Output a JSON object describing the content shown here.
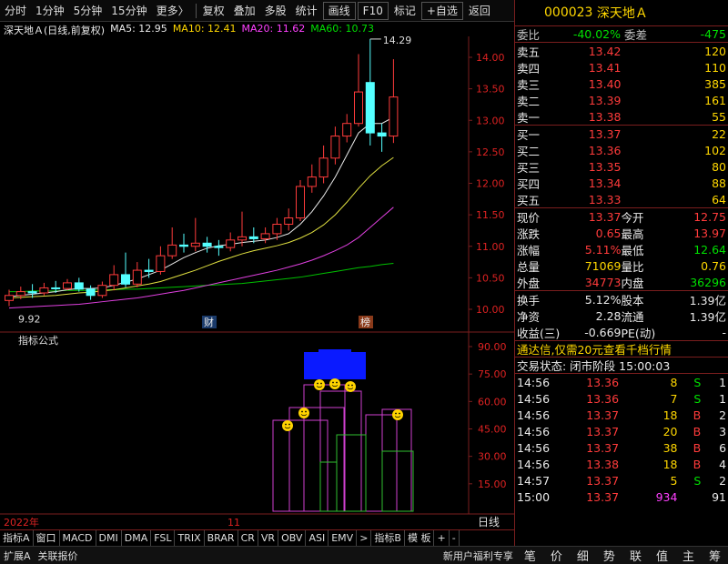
{
  "toolbar": {
    "items": [
      "分时",
      "1分钟",
      "5分钟",
      "15分钟",
      "更多〉"
    ],
    "buttons": [
      "复权",
      "叠加",
      "多股",
      "统计",
      "画线",
      "F10",
      "标记",
      "+自选",
      "返回"
    ]
  },
  "legend": {
    "name": "深天地Ａ(日线,前复权)",
    "ma5": "MA5: 12.95",
    "ma10": "MA10: 12.41",
    "ma20": "MA20: 11.62",
    "ma60": "MA60: 10.73"
  },
  "chart_data": {
    "type": "candlestick",
    "price_axis": [
      "14.00",
      "13.50",
      "13.00",
      "12.50",
      "12.00",
      "11.50",
      "11.00",
      "10.50",
      "10.00"
    ],
    "high_label": "14.29",
    "low_label": "9.92",
    "markers": [
      "财",
      "榜"
    ],
    "indicator_title": "指标公式",
    "indicator_axis": [
      "90.00",
      "75.00",
      "60.00",
      "45.00",
      "30.00",
      "15.00"
    ],
    "date_labels": [
      "2022年",
      "11"
    ],
    "daily_label": "日线",
    "candles": [
      {
        "o": 10.14,
        "c": 10.22,
        "h": 10.31,
        "l": 10.05
      },
      {
        "o": 10.22,
        "c": 10.28,
        "h": 10.36,
        "l": 10.16
      },
      {
        "o": 10.28,
        "c": 10.26,
        "h": 10.4,
        "l": 10.18
      },
      {
        "o": 10.26,
        "c": 10.34,
        "h": 10.42,
        "l": 10.22
      },
      {
        "o": 10.34,
        "c": 10.33,
        "h": 10.45,
        "l": 10.26
      },
      {
        "o": 10.33,
        "c": 10.42,
        "h": 10.48,
        "l": 10.3
      },
      {
        "o": 10.42,
        "c": 10.32,
        "h": 10.5,
        "l": 10.28
      },
      {
        "o": 10.32,
        "c": 10.22,
        "h": 10.38,
        "l": 10.15
      },
      {
        "o": 10.22,
        "c": 10.38,
        "h": 10.44,
        "l": 10.18
      },
      {
        "o": 10.38,
        "c": 10.55,
        "h": 10.7,
        "l": 10.3
      },
      {
        "o": 10.55,
        "c": 10.4,
        "h": 10.9,
        "l": 10.35
      },
      {
        "o": 10.4,
        "c": 10.62,
        "h": 10.75,
        "l": 10.35
      },
      {
        "o": 10.62,
        "c": 10.6,
        "h": 10.8,
        "l": 10.5
      },
      {
        "o": 10.6,
        "c": 10.85,
        "h": 11.0,
        "l": 10.55
      },
      {
        "o": 10.85,
        "c": 11.02,
        "h": 11.3,
        "l": 10.8
      },
      {
        "o": 11.02,
        "c": 11.0,
        "h": 11.2,
        "l": 10.9
      },
      {
        "o": 11.0,
        "c": 11.05,
        "h": 11.45,
        "l": 10.92
      },
      {
        "o": 11.05,
        "c": 11.0,
        "h": 11.15,
        "l": 10.9
      },
      {
        "o": 11.0,
        "c": 10.98,
        "h": 11.1,
        "l": 10.85
      },
      {
        "o": 10.98,
        "c": 11.1,
        "h": 11.22,
        "l": 10.92
      },
      {
        "o": 11.1,
        "c": 11.15,
        "h": 11.55,
        "l": 11.0
      },
      {
        "o": 11.15,
        "c": 11.12,
        "h": 11.3,
        "l": 11.05
      },
      {
        "o": 11.12,
        "c": 11.2,
        "h": 11.3,
        "l": 11.05
      },
      {
        "o": 11.2,
        "c": 11.35,
        "h": 11.45,
        "l": 11.1
      },
      {
        "o": 11.35,
        "c": 11.45,
        "h": 11.6,
        "l": 11.25
      },
      {
        "o": 11.45,
        "c": 11.95,
        "h": 12.05,
        "l": 11.4
      },
      {
        "o": 11.95,
        "c": 12.1,
        "h": 12.3,
        "l": 11.85
      },
      {
        "o": 12.1,
        "c": 12.4,
        "h": 12.6,
        "l": 12.0
      },
      {
        "o": 12.4,
        "c": 12.75,
        "h": 12.9,
        "l": 12.3
      },
      {
        "o": 12.75,
        "c": 12.95,
        "h": 13.1,
        "l": 12.65
      },
      {
        "o": 12.95,
        "c": 13.45,
        "h": 14.05,
        "l": 12.9
      },
      {
        "o": 13.6,
        "c": 12.8,
        "h": 14.29,
        "l": 12.6
      },
      {
        "o": 12.8,
        "c": 12.75,
        "h": 12.95,
        "l": 12.5
      },
      {
        "o": 12.75,
        "c": 13.37,
        "h": 13.97,
        "l": 12.64
      }
    ],
    "ma5": [
      10.2,
      10.22,
      10.24,
      10.26,
      10.28,
      10.31,
      10.33,
      10.33,
      10.34,
      10.38,
      10.43,
      10.48,
      10.55,
      10.62,
      10.72,
      10.82,
      10.9,
      10.97,
      11.01,
      11.03,
      11.06,
      11.08,
      11.1,
      11.14,
      11.2,
      11.35,
      11.55,
      11.8,
      12.1,
      12.45,
      12.8,
      12.95,
      12.95,
      13.05
    ],
    "ma10": [
      10.18,
      10.19,
      10.2,
      10.21,
      10.22,
      10.24,
      10.26,
      10.27,
      10.29,
      10.31,
      10.34,
      10.37,
      10.4,
      10.44,
      10.5,
      10.56,
      10.62,
      10.69,
      10.76,
      10.82,
      10.88,
      10.93,
      10.97,
      11.01,
      11.06,
      11.13,
      11.22,
      11.34,
      11.5,
      11.7,
      11.92,
      12.12,
      12.28,
      12.41
    ],
    "ma20": [
      10.02,
      10.03,
      10.04,
      10.05,
      10.06,
      10.07,
      10.08,
      10.1,
      10.12,
      10.14,
      10.16,
      10.18,
      10.21,
      10.24,
      10.27,
      10.3,
      10.34,
      10.38,
      10.42,
      10.46,
      10.5,
      10.54,
      10.58,
      10.62,
      10.67,
      10.72,
      10.78,
      10.85,
      10.93,
      11.02,
      11.14,
      11.3,
      11.46,
      11.62
    ],
    "ma60": [
      10.28,
      10.28,
      10.29,
      10.29,
      10.29,
      10.3,
      10.3,
      10.3,
      10.31,
      10.31,
      10.32,
      10.32,
      10.33,
      10.34,
      10.35,
      10.36,
      10.37,
      10.38,
      10.39,
      10.4,
      10.41,
      10.43,
      10.45,
      10.47,
      10.49,
      10.51,
      10.54,
      10.57,
      10.6,
      10.63,
      10.66,
      10.68,
      10.71,
      10.73
    ]
  },
  "quote": {
    "code": "000023",
    "name": "深天地Ａ",
    "weibi_label": "委比",
    "weibi": "-40.02%",
    "weicha_label": "委差",
    "weicha": "-475",
    "sells": [
      {
        "label": "卖五",
        "price": "13.42",
        "vol": "120"
      },
      {
        "label": "卖四",
        "price": "13.41",
        "vol": "110"
      },
      {
        "label": "卖三",
        "price": "13.40",
        "vol": "385"
      },
      {
        "label": "卖二",
        "price": "13.39",
        "vol": "161"
      },
      {
        "label": "卖一",
        "price": "13.38",
        "vol": "55"
      }
    ],
    "buys": [
      {
        "label": "买一",
        "price": "13.37",
        "vol": "22"
      },
      {
        "label": "买二",
        "price": "13.36",
        "vol": "102"
      },
      {
        "label": "买三",
        "price": "13.35",
        "vol": "80"
      },
      {
        "label": "买四",
        "price": "13.34",
        "vol": "88"
      },
      {
        "label": "买五",
        "price": "13.33",
        "vol": "64"
      }
    ],
    "stats": [
      [
        "现价",
        "13.37",
        "今开",
        "12.75"
      ],
      [
        "涨跌",
        "0.65",
        "最高",
        "13.97"
      ],
      [
        "涨幅",
        "5.11%",
        "最低",
        "12.64"
      ],
      [
        "总量",
        "71069",
        "量比",
        "0.76"
      ],
      [
        "外盘",
        "34773",
        "内盘",
        "36296"
      ]
    ],
    "stats2": [
      [
        "换手",
        "5.12%",
        "股本",
        "1.39亿"
      ],
      [
        "净资",
        "2.28",
        "流通",
        "1.39亿"
      ],
      [
        "收益(三)",
        "-0.669",
        "PE(动)",
        "-"
      ]
    ],
    "promo": "通达信,仅需20元查看千档行情",
    "trade_state": "交易状态: 闭市阶段 15:00:03",
    "ticks": [
      [
        "14:56",
        "13.36",
        "8",
        "S",
        "1"
      ],
      [
        "14:56",
        "13.36",
        "7",
        "S",
        "1"
      ],
      [
        "14:56",
        "13.37",
        "18",
        "B",
        "2"
      ],
      [
        "14:56",
        "13.37",
        "20",
        "B",
        "3"
      ],
      [
        "14:56",
        "13.37",
        "38",
        "B",
        "6"
      ],
      [
        "14:56",
        "13.38",
        "18",
        "B",
        "4"
      ],
      [
        "14:57",
        "13.37",
        "5",
        "S",
        "2"
      ],
      [
        "15:00",
        "13.37",
        "934",
        "",
        "91"
      ]
    ]
  },
  "bottom_tabs": [
    "指标A",
    "窗口",
    "MACD",
    "DMI",
    "DMA",
    "FSL",
    "TRIX",
    "BRAR",
    "CR",
    "VR",
    "OBV",
    "ASI",
    "EMV",
    ">",
    "指标B",
    "模 板",
    "+",
    "-"
  ],
  "status_bar": {
    "left": [
      "扩展A",
      "关联报价"
    ],
    "promo": "新用户福利专享",
    "tabs": [
      "笔",
      "价",
      "细",
      "势",
      "联",
      "值",
      "主",
      "筹"
    ]
  }
}
